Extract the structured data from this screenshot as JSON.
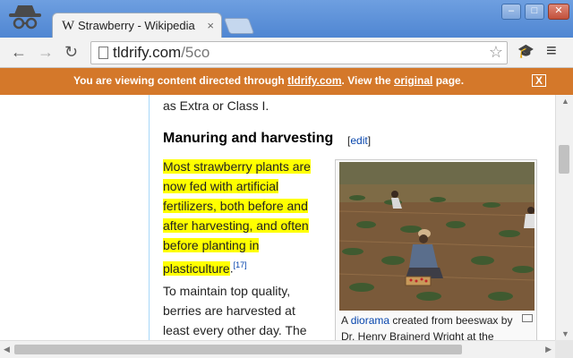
{
  "tab": {
    "favicon": "W",
    "title": "Strawberry - Wikipedia",
    "close": "×"
  },
  "window": {
    "minimize": "–",
    "maximize": "□",
    "close": "✕"
  },
  "toolbar": {
    "back": "←",
    "forward": "→",
    "reload": "↻",
    "url_domain": "tldrify.com",
    "url_path": "/5co",
    "star": "☆",
    "ext_icon": "🎓",
    "menu": "≡"
  },
  "banner": {
    "prefix": "You are viewing content directed through ",
    "domain": "tldrify.com",
    "middle": ". View the ",
    "original": "original",
    "suffix": " page.",
    "close": "X",
    "color": "#d4782a"
  },
  "article": {
    "prev_line": "as Extra or Class I.",
    "heading": "Manuring and harvesting",
    "edit_open": "[",
    "edit": "edit",
    "edit_close": "]",
    "highlight_lines": [
      "Most strawberry plants are",
      "now fed with artificial",
      "fertilizers, both before and",
      "after harvesting, and often",
      "before planting in",
      "plasticulture"
    ],
    "highlight_end": ".",
    "ref": "[17]",
    "para2_lines": [
      "To maintain top quality,",
      "berries are harvested at",
      "least every other day. The"
    ],
    "caption_prefix": "A ",
    "caption_link": "diorama",
    "caption_line1_rest": " created from beeswax by",
    "caption_line2": "Dr. Henry Brainerd Wright at the",
    "highlight_color": "#ffff00"
  }
}
